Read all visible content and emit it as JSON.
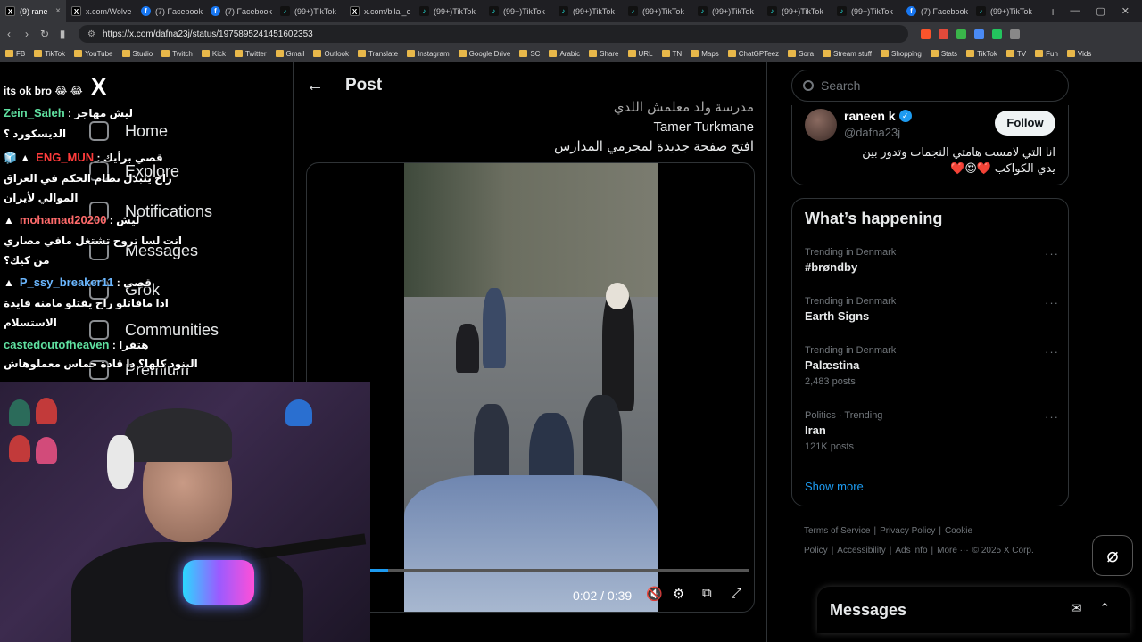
{
  "browser": {
    "tabs": [
      {
        "label": "(9) rane",
        "icon": "x",
        "active": true
      },
      {
        "label": "x.com/Wolve",
        "icon": "x"
      },
      {
        "label": "(7) Facebook",
        "icon": "fb"
      },
      {
        "label": "(7) Facebook",
        "icon": "fb"
      },
      {
        "label": "(99+)TikTok",
        "icon": "tt"
      },
      {
        "label": "x.com/bilal_e",
        "icon": "x"
      },
      {
        "label": "(99+)TikTok",
        "icon": "tt"
      },
      {
        "label": "(99+)TikTok",
        "icon": "tt"
      },
      {
        "label": "(99+)TikTok",
        "icon": "tt"
      },
      {
        "label": "(99+)TikTok",
        "icon": "tt"
      },
      {
        "label": "(99+)TikTok",
        "icon": "tt"
      },
      {
        "label": "(99+)TikTok",
        "icon": "tt"
      },
      {
        "label": "(99+)TikTok",
        "icon": "tt"
      },
      {
        "label": "(7) Facebook",
        "icon": "fb"
      },
      {
        "label": "(99+)TikTok",
        "icon": "tt"
      }
    ],
    "url": "https://x.com/dafna23j/status/1975895241451602353",
    "bookmarks": [
      "FB",
      "TikTok",
      "YouTube",
      "Studio",
      "Twitch",
      "Kick",
      "Twitter",
      "Gmail",
      "Outlook",
      "Translate",
      "Instagram",
      "Google Drive",
      "SC",
      "Arabic",
      "Share",
      "URL",
      "TN",
      "Maps",
      "ChatGPTeez",
      "Sora",
      "Stream stuff",
      "Shopping",
      "Stats",
      "TikTok",
      "TV",
      "Fun",
      "Vids"
    ]
  },
  "x_nav": {
    "logo": "X",
    "items": [
      "Home",
      "Explore",
      "Notifications",
      "Messages",
      "Grok",
      "Communities",
      "Premium"
    ]
  },
  "post": {
    "header_title": "Post",
    "text_lines": [
      "مدرسة ولد معلمش اللدي",
      "Tamer Turkmane",
      "افتح صفحة جديدة لمجرمي المدارس"
    ],
    "video": {
      "time": "0:02 / 0:39",
      "progress": 0.05
    }
  },
  "sidebar": {
    "search_placeholder": "Search",
    "profile": {
      "name": "raneen k",
      "handle": "@dafna23j",
      "follow_label": "Follow",
      "bio_line1": "انا التي لامست هامتي النجمات وتدور بين",
      "bio_line2": "يدي الكواكب ❤️😍❤️"
    },
    "happening": {
      "title": "What’s happening",
      "trends": [
        {
          "context": "Trending in Denmark",
          "name": "#brøndby",
          "posts": ""
        },
        {
          "context": "Trending in Denmark",
          "name": "Earth Signs",
          "posts": ""
        },
        {
          "context": "Trending in Denmark",
          "name": "Palæstina",
          "posts": "2,483 posts"
        },
        {
          "context": "Politics · Trending",
          "name": "Iran",
          "posts": "121K posts"
        }
      ],
      "more_icon": "···",
      "show_more": "Show more"
    },
    "footer": {
      "links": [
        "Terms of Service",
        "|",
        "Privacy Policy",
        "|",
        "Cookie Policy",
        "|",
        "Accessibility",
        "|",
        "Ads info",
        "|",
        "More ···",
        "© 2025 X Corp."
      ]
    }
  },
  "messages_bar": {
    "title": "Messages"
  },
  "chat": {
    "lines": [
      {
        "user": "",
        "text": "its ok bro 😂 😂",
        "color": "#ffffff"
      },
      {
        "user": "Zein_Saleh",
        "text": " : ليش مهاجر",
        "color": "#5fe0a0"
      },
      {
        "user": "",
        "text": "الديسكورد ؟",
        "color": "#ffffff"
      },
      {
        "user": "ENG_MUN",
        "text": " : قصي برأيك",
        "color": "#ff3b3b",
        "prefix": "🧊 ▲"
      },
      {
        "user": "",
        "text": "راح يتبدل نظام الحكم في العراق",
        "color": "#ffffff"
      },
      {
        "user": "",
        "text": "الموالي لأيران",
        "color": "#ffffff"
      },
      {
        "user": "mohamad20200",
        "text": " : ليش",
        "color": "#ff6b6b",
        "prefix": "▲"
      },
      {
        "user": "",
        "text": "انت لسا تروح تشتغل مافي مصاري",
        "color": "#ffffff"
      },
      {
        "user": "",
        "text": "من كيك؟",
        "color": "#ffffff"
      },
      {
        "user": "P_ssy_breaker11",
        "text": " : قصي",
        "color": "#6bb7ff",
        "prefix": "▲"
      },
      {
        "user": "",
        "text": "ادا مافاتلو راح يقتلو مامنه فايدة",
        "color": "#ffffff"
      },
      {
        "user": "",
        "text": "الاستسلام",
        "color": "#ffffff"
      },
      {
        "user": "castedoutofheaven",
        "text": " : هتقرا",
        "color": "#5fe0a0"
      },
      {
        "user": "",
        "text": "البنود كلها؟ دا قادة حماس معملوهاش",
        "color": "#ffffff"
      }
    ]
  },
  "colors": {
    "accent": "#1d9bf0",
    "background": "#000000",
    "border": "#2f3336",
    "muted": "#71767b"
  }
}
